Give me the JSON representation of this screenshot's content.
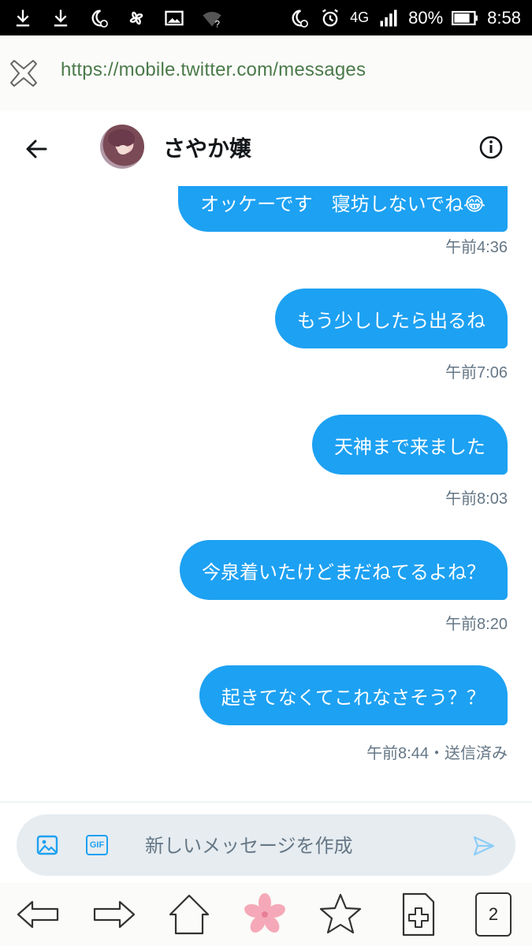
{
  "status_bar": {
    "network": "4G",
    "battery": "80%",
    "time": "8:58"
  },
  "url_bar": {
    "url": "https://mobile.twitter.com/messages"
  },
  "chat": {
    "name": "さやか嬢"
  },
  "messages": [
    {
      "text": "オッケーです　寝坊しないでね😂",
      "time": "午前4:36"
    },
    {
      "text": "もう少ししたら出るね",
      "time": "午前7:06"
    },
    {
      "text": "天神まで来ました",
      "time": "午前8:03"
    },
    {
      "text": "今泉着いたけどまだねてるよね？",
      "time": "午前8:20"
    },
    {
      "text": "起きてなくてこれなさそう？？",
      "time": "午前8:44・送信済み"
    }
  ],
  "composer": {
    "gif_label": "GIF",
    "placeholder": "新しいメッセージを作成"
  },
  "bottom_nav": {
    "tab_count": "2"
  },
  "colors": {
    "bubble": "#1da1f2",
    "timestamp": "#657786",
    "url_text": "#4b7a4a"
  }
}
